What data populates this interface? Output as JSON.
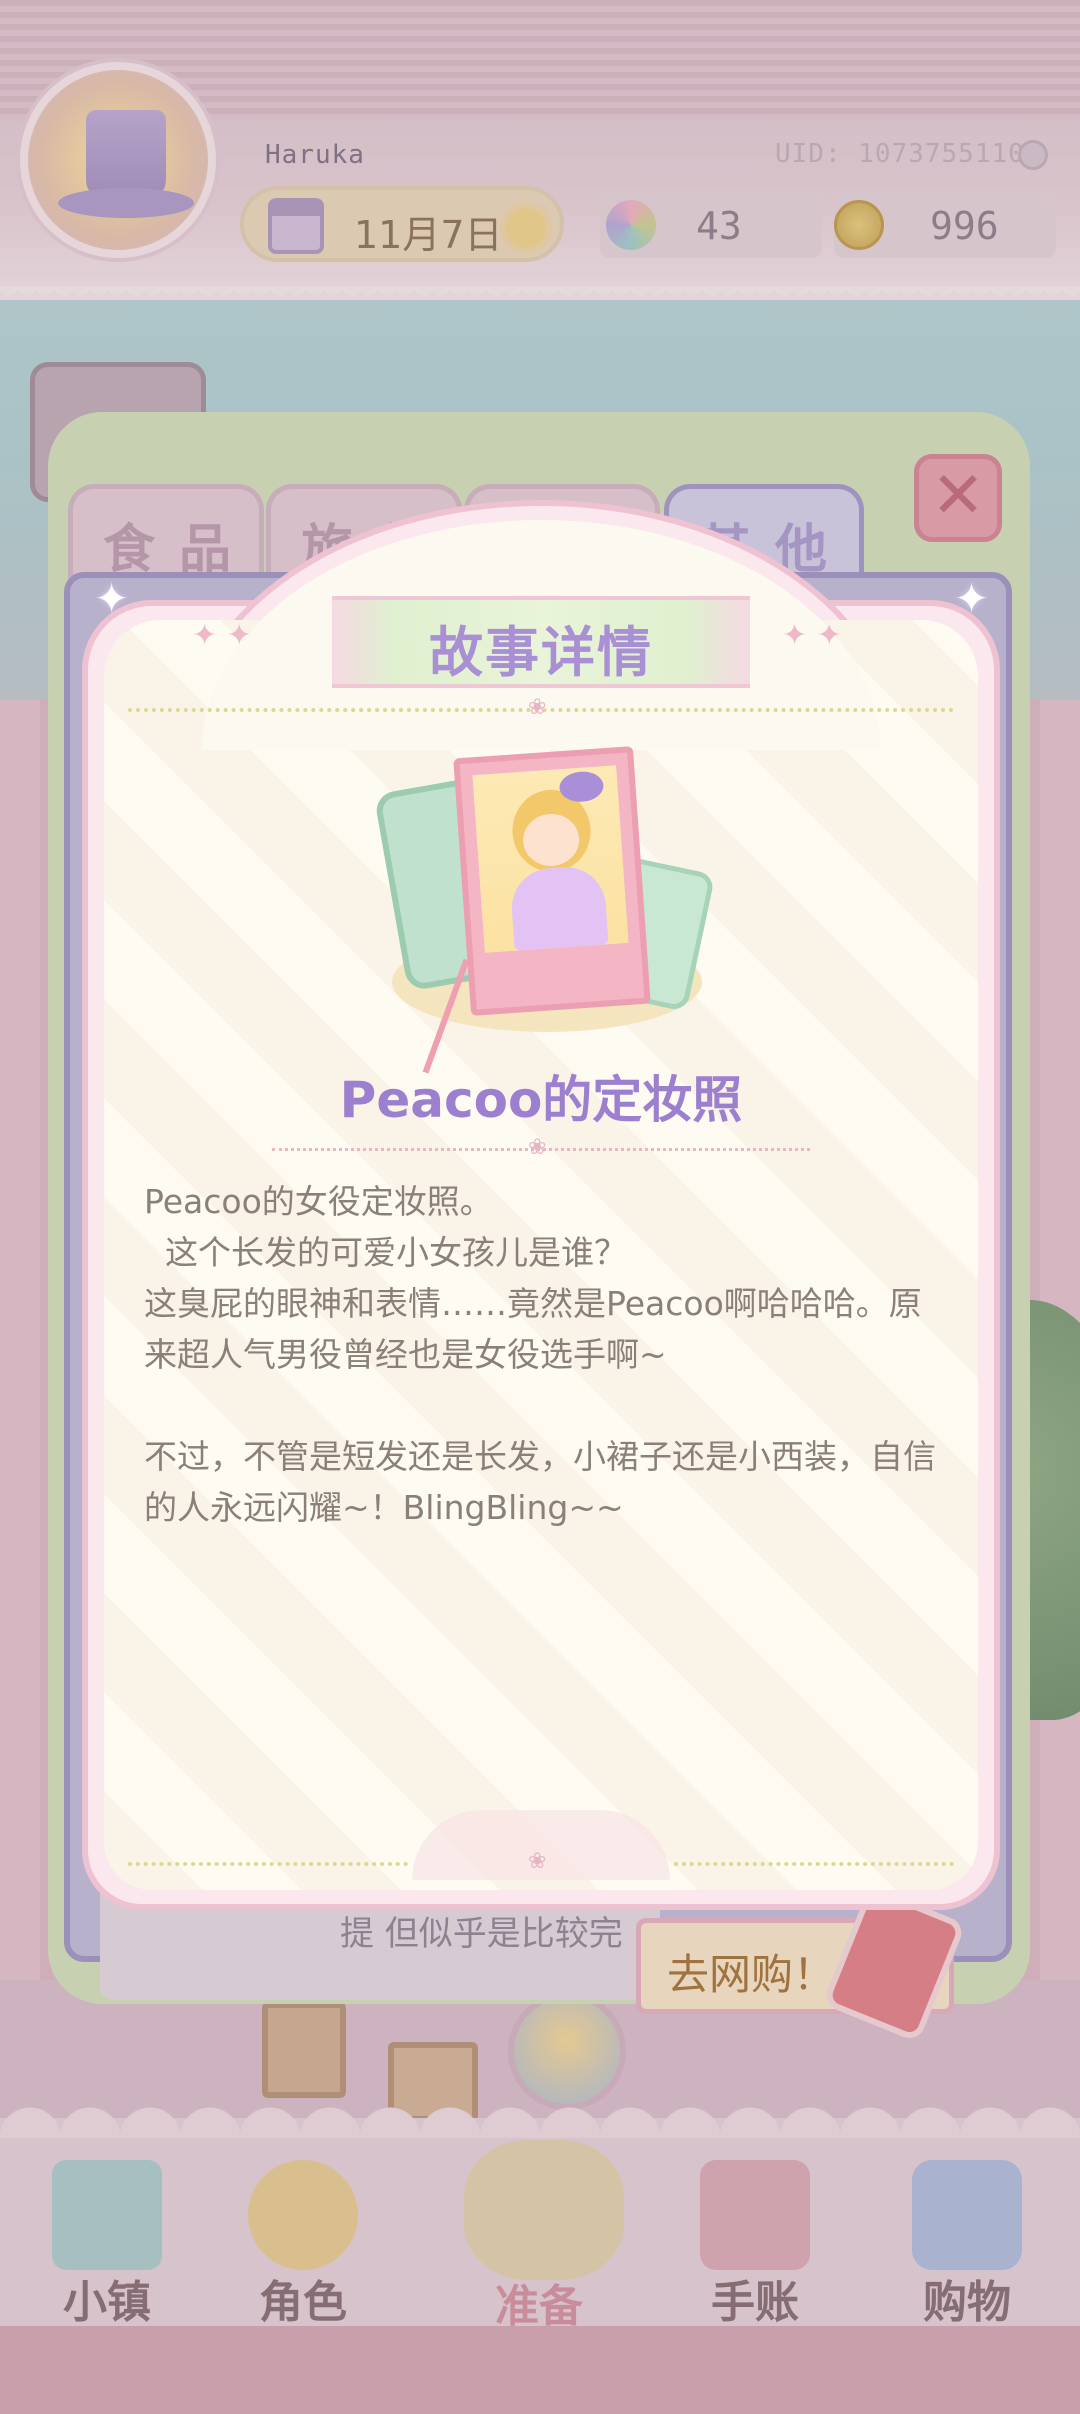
{
  "hud": {
    "player_name": "Haruka",
    "uid": "UID: 1073755110",
    "date": "11月7日",
    "weather_icon": "sun-icon",
    "flower_count": "43",
    "coin_count": "996"
  },
  "shop": {
    "tabs": [
      {
        "label": "食品"
      },
      {
        "label": "旅行"
      },
      {
        "label": ""
      },
      {
        "label": "其他"
      }
    ],
    "partial_card_text": "提 但似乎是比较完",
    "go_shop_label": "去网购！"
  },
  "modal": {
    "title": "故事详情",
    "item_name": "Peacoo的定妆照",
    "description": "Peacoo的女役定妆照。\n  这个长发的可爱小女孩儿是谁？\n这臭屁的眼神和表情……竟然是Peacoo啊哈哈哈。原来超人气男役曾经也是女役选手啊~\n\n不过，不管是短发还是长发，小裙子还是小西装，自信的人永远闪耀~！BlingBling~~"
  },
  "bottom_nav": [
    {
      "label": "小镇",
      "icon": "map-icon"
    },
    {
      "label": "角色",
      "icon": "character-icon"
    },
    {
      "label": "准备",
      "icon": "picnic-basket-icon"
    },
    {
      "label": "手账",
      "icon": "diary-icon"
    },
    {
      "label": "购物",
      "icon": "shopping-bag-icon"
    }
  ],
  "colors": {
    "modal_title": "#a98fd4",
    "item_name": "#9d7fd0",
    "description_text": "#8a8079",
    "modal_border": "#efc2d1"
  }
}
